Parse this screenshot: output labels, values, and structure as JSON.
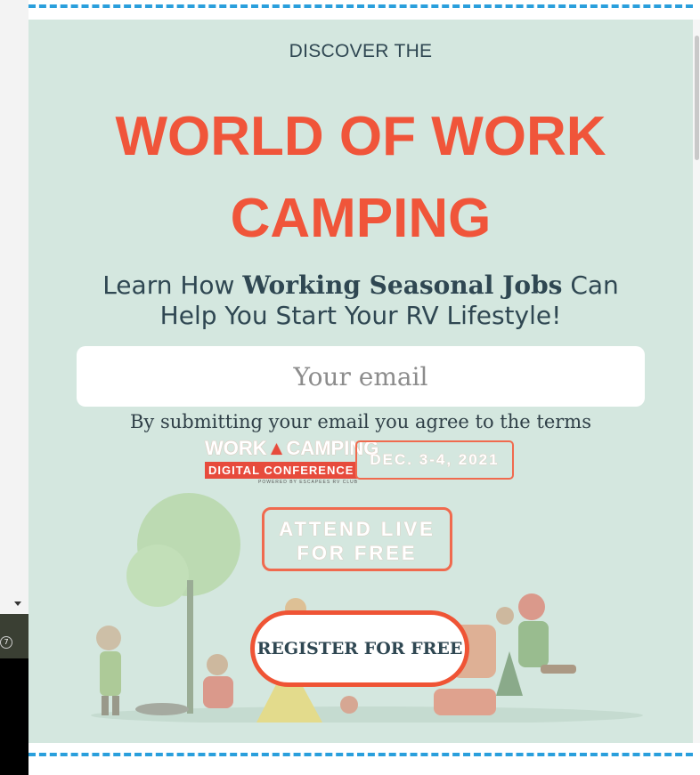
{
  "left_badge": "7",
  "hero": {
    "eyebrow": "DISCOVER THE",
    "headline_line1": "WORLD OF WORK",
    "headline_line2": "CAMPING",
    "sub_pre": "Learn How ",
    "sub_bold": "Working Seasonal Jobs",
    "sub_post": " Can",
    "sub_line2": "Help You Start Your RV Lifestyle!"
  },
  "form": {
    "email_placeholder": "Your email",
    "agree_text": "By submitting your email you agree to the ",
    "terms_link": "terms"
  },
  "event": {
    "logo_word_left": "WORK",
    "logo_word_right": "CAMPING",
    "logo_band": "DIGITAL CONFERENCE",
    "logo_small": "POWERED BY ESCAPEES RV CLUB",
    "date": "DEC. 3-4, 2021",
    "attend_line1": "ATTEND LIVE",
    "attend_line2": "FOR FREE"
  },
  "cta": {
    "register_label": "REGISTER FOR FREE"
  },
  "colors": {
    "accent": "#f0553a",
    "panel_bg": "#d4e7df",
    "dash": "#2a9fdc",
    "text_dark": "#2f4752"
  }
}
